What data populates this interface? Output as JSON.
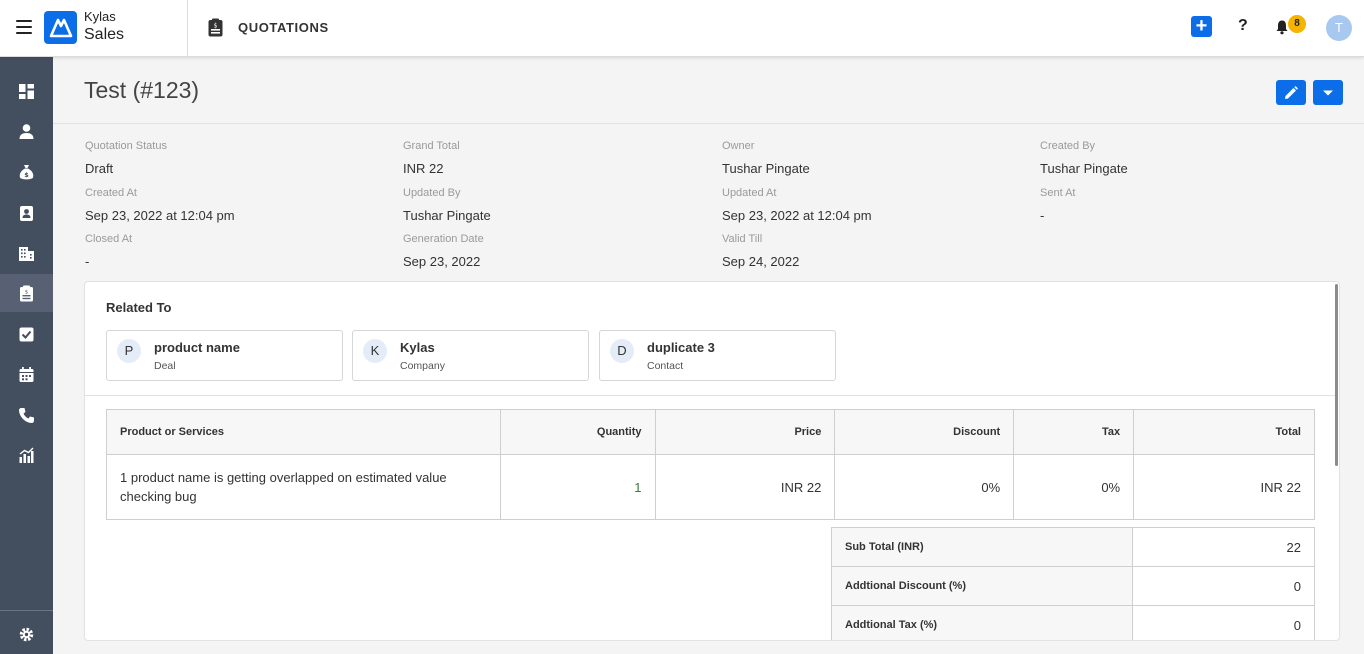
{
  "header": {
    "brand_top": "Kylas",
    "brand_bottom": "Sales",
    "page_label": "QUOTATIONS",
    "help": "?",
    "notification_count": "8",
    "avatar_initial": "T"
  },
  "sidebar": {
    "items": [
      {
        "icon": "dashboard-icon"
      },
      {
        "icon": "user-icon"
      },
      {
        "icon": "money-bag-icon"
      },
      {
        "icon": "contact-card-icon"
      },
      {
        "icon": "building-icon"
      },
      {
        "icon": "quotation-icon",
        "active": true
      },
      {
        "icon": "task-check-icon"
      },
      {
        "icon": "calendar-icon"
      },
      {
        "icon": "phone-icon"
      },
      {
        "icon": "reports-icon"
      }
    ],
    "footer_icon": "gear-icon"
  },
  "quotation": {
    "title": "Test (#123)",
    "fields": [
      {
        "label": "Quotation Status",
        "value": "Draft"
      },
      {
        "label": "Grand Total",
        "value": "INR 22"
      },
      {
        "label": "Owner",
        "value": "Tushar Pingate"
      },
      {
        "label": "Created By",
        "value": "Tushar Pingate"
      },
      {
        "label": "Created At",
        "value": "Sep 23, 2022 at 12:04 pm"
      },
      {
        "label": "Updated By",
        "value": "Tushar Pingate"
      },
      {
        "label": "Updated At",
        "value": "Sep 23, 2022 at 12:04 pm"
      },
      {
        "label": "Sent At",
        "value": "-"
      },
      {
        "label": "Closed At",
        "value": "-"
      },
      {
        "label": "Generation Date",
        "value": "Sep 23, 2022"
      },
      {
        "label": "Valid Till",
        "value": "Sep 24, 2022"
      }
    ]
  },
  "related": {
    "title": "Related To",
    "cards": [
      {
        "initial": "P",
        "name": "product name",
        "type": "Deal"
      },
      {
        "initial": "K",
        "name": "Kylas",
        "type": "Company"
      },
      {
        "initial": "D",
        "name": "duplicate 3",
        "type": "Contact"
      }
    ]
  },
  "products": {
    "headers": [
      "Product or Services",
      "Quantity",
      "Price",
      "Discount",
      "Tax",
      "Total"
    ],
    "rows": [
      [
        "1 product name is getting overlapped on estimated value checking bug",
        "1",
        "INR 22",
        "0%",
        "0%",
        "INR 22"
      ]
    ]
  },
  "totals": [
    {
      "label": "Sub Total (INR)",
      "value": "22"
    },
    {
      "label": "Addtional Discount (%)",
      "value": "0"
    },
    {
      "label": "Addtional Tax (%)",
      "value": "0"
    }
  ],
  "colors": {
    "accent": "#0b6ee8",
    "sidebar": "#434e5f",
    "badge": "#f5b400"
  }
}
